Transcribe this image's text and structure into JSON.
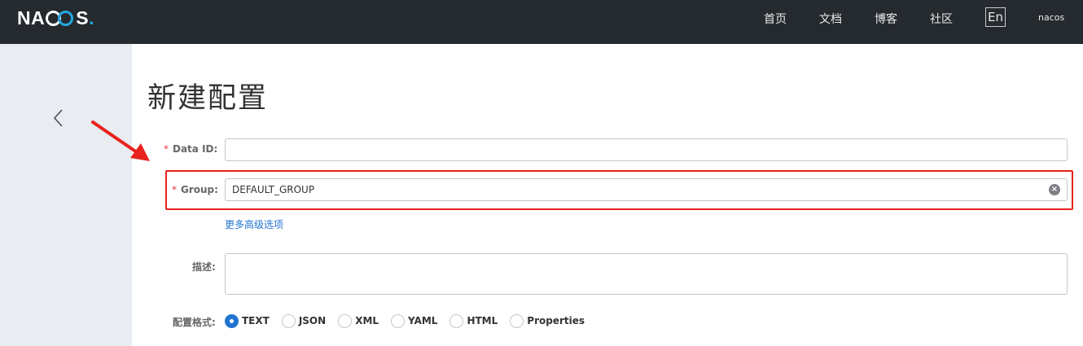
{
  "header": {
    "logo_text_left": "NA",
    "logo_text_right": "S",
    "logo_dot": ".",
    "nav": [
      "首页",
      "文档",
      "博客",
      "社区"
    ],
    "lang_button": "En",
    "user": "nacos"
  },
  "page": {
    "title": "新建配置"
  },
  "form": {
    "required_mark": "*",
    "data_id_label": "Data ID:",
    "data_id_value": "",
    "group_label": "Group:",
    "group_value": "DEFAULT_GROUP",
    "advanced_link": "更多高级选项",
    "description_label": "描述:",
    "description_value": "",
    "format_label": "配置格式:",
    "formats": [
      "TEXT",
      "JSON",
      "XML",
      "YAML",
      "HTML",
      "Properties"
    ],
    "selected_format": "TEXT"
  },
  "colors": {
    "header_bg": "#252a2f",
    "sidebar_bg": "#e9ecf0",
    "accent": "#2174d1",
    "annotation_red": "#e8221d",
    "required_red": "#e8363a"
  },
  "icons": {
    "back": "chevron-left-icon",
    "clear": "clear-circle-icon",
    "annotation": "red-arrow-icon"
  }
}
